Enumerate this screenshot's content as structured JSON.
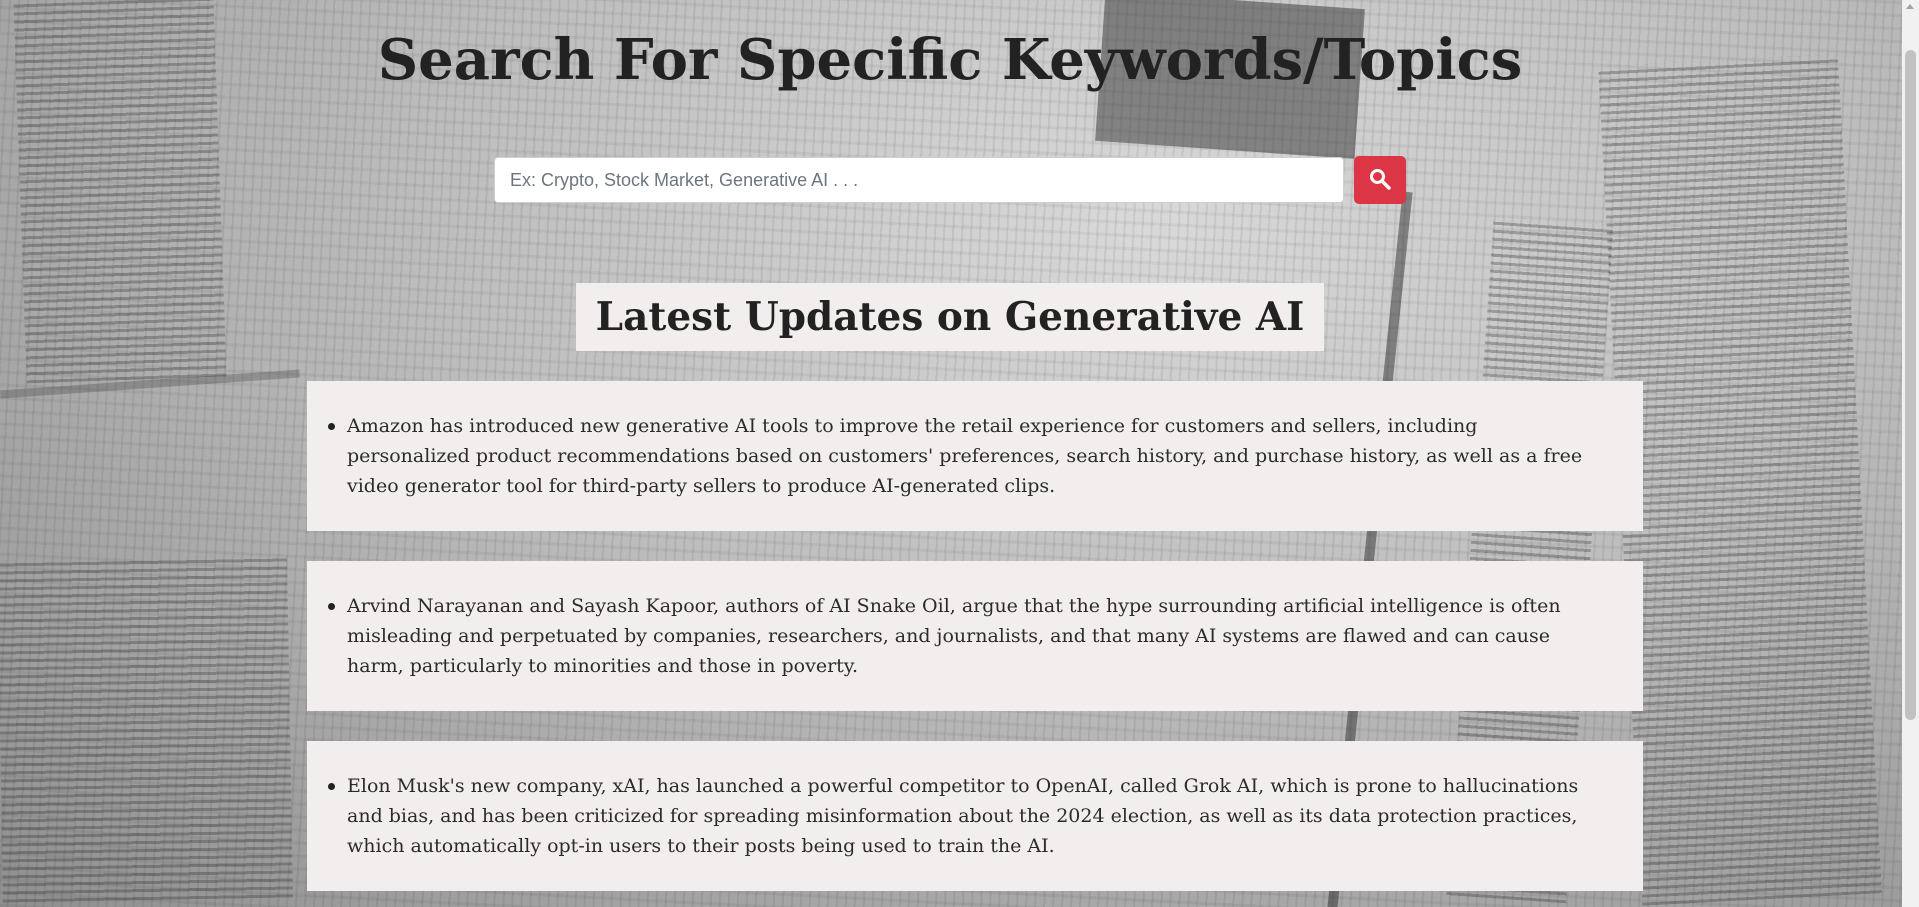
{
  "page": {
    "title": "Search For Specific Keywords/Topics"
  },
  "search": {
    "placeholder": "Ex: Crypto, Stock Market, Generative AI . . .",
    "value": "",
    "button_icon": "search-icon",
    "button_color": "#dc3545"
  },
  "section": {
    "heading": "Latest Updates on Generative AI"
  },
  "updates": [
    {
      "text": "Amazon has introduced new generative AI tools to improve the retail experience for customers and sellers, including personalized product recommendations based on customers' preferences, search history, and purchase history, as well as a free video generator tool for third-party sellers to produce AI-generated clips."
    },
    {
      "text": "Arvind Narayanan and Sayash Kapoor, authors of AI Snake Oil, argue that the hype surrounding artificial intelligence is often misleading and perpetuated by companies, researchers, and journalists, and that many AI systems are flawed and can cause harm, particularly to minorities and those in poverty."
    },
    {
      "text": "Elon Musk's new company, xAI, has launched a powerful competitor to OpenAI, called Grok AI, which is prone to hallucinations and bias, and has been criticized for spreading misinformation about the 2024 election, as well as its data protection practices, which automatically opt-in users to their posts being used to train the AI."
    }
  ],
  "colors": {
    "card_background": "#f2eeed",
    "text": "#222222"
  }
}
